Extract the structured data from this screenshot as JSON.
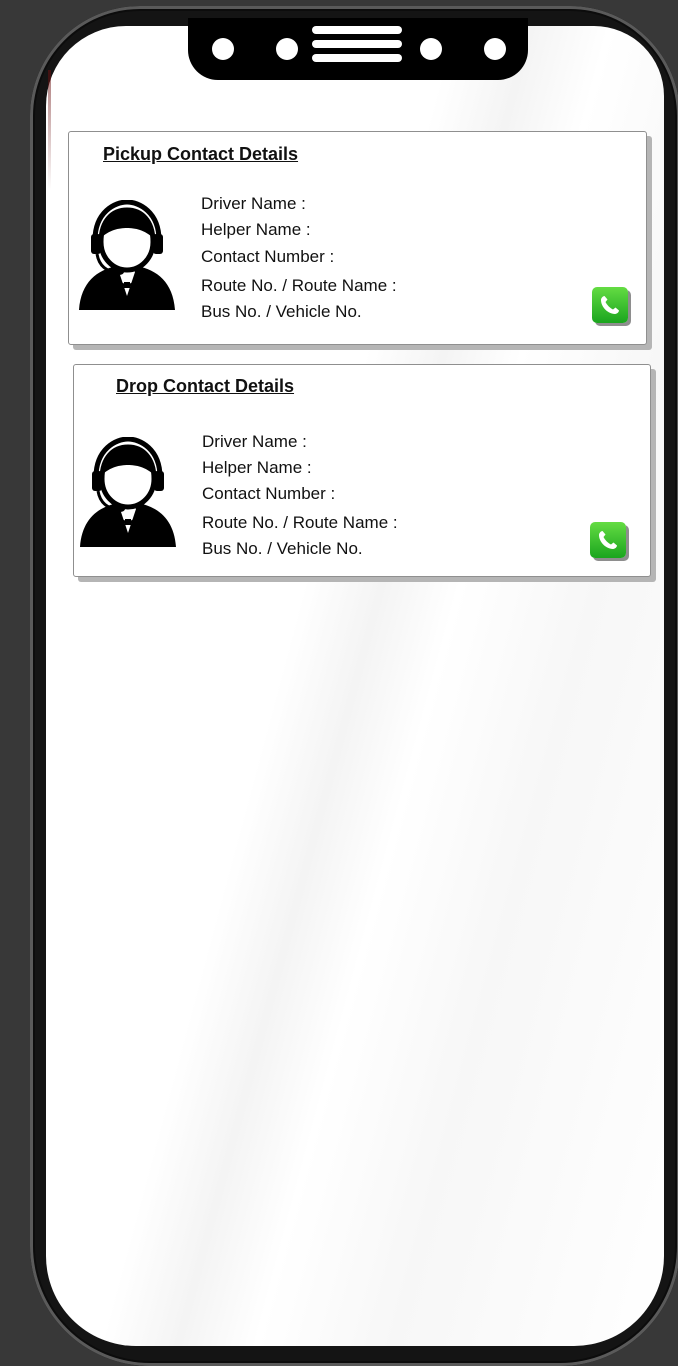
{
  "pickup": {
    "title": "Pickup Contact Details",
    "fields": [
      "Driver Name :",
      "Helper Name :",
      "Contact Number :",
      "Route No. / Route Name :",
      "Bus No. / Vehicle No."
    ],
    "avatar_icon": "driver-headset-icon",
    "call_icon": "phone-call-icon"
  },
  "drop": {
    "title": "Drop Contact Details",
    "fields": [
      "Driver Name :",
      "Helper Name :",
      "Contact Number :",
      "Route No. / Route Name :",
      "Bus No. / Vehicle No."
    ],
    "avatar_icon": "driver-headset-icon",
    "call_icon": "phone-call-icon"
  },
  "colors": {
    "call_button": "#2fbf2a",
    "page_background": "#383838",
    "phone_frame": "#141414"
  }
}
